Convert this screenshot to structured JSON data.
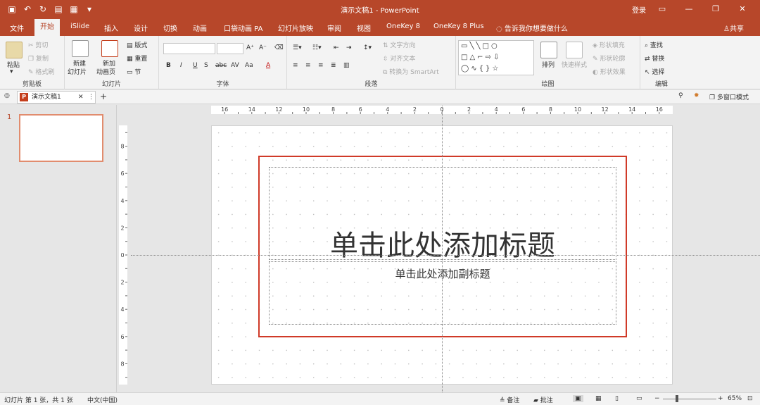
{
  "titlebar": {
    "doc_title": "演示文稿1  -  PowerPoint",
    "login": "登录",
    "qat": [
      "save-icon",
      "undo-icon",
      "redo-icon",
      "start-from-beginning-icon",
      "save-as-icon",
      "customize-icon"
    ]
  },
  "tabs": [
    "文件",
    "开始",
    "iSlide",
    "插入",
    "设计",
    "切换",
    "动画",
    "口袋动画 PA",
    "幻灯片放映",
    "审阅",
    "视图",
    "OneKey 8",
    "OneKey 8 Plus"
  ],
  "active_tab": "开始",
  "tellme": "告诉我你想要做什么",
  "share": "共享",
  "ribbon": {
    "clipboard": {
      "label": "剪贴板",
      "paste": "粘贴",
      "cut": "剪切",
      "copy": "复制",
      "format_painter": "格式刷"
    },
    "slides": {
      "label": "幻灯片",
      "new_slide": "新建\n幻灯片",
      "new_slide_l1": "新建",
      "new_slide_l2": "幻灯片",
      "add_page_l1": "新加",
      "add_page_l2": "动画页",
      "layout": "版式",
      "reset": "重置",
      "section": "节"
    },
    "font": {
      "label": "字体",
      "bold": "B",
      "italic": "I",
      "underline": "U",
      "shadow": "S",
      "strike": "abc",
      "spacing": "AV",
      "case": "Aa",
      "color": "A"
    },
    "paragraph": {
      "label": "段落",
      "text_direction": "文字方向",
      "align_text": "对齐文本",
      "smartart": "转换为 SmartArt"
    },
    "drawing": {
      "label": "绘图",
      "arrange": "排列",
      "quick_styles": "快速样式",
      "fill": "形状填充",
      "outline": "形状轮廓",
      "effects": "形状效果"
    },
    "editing": {
      "label": "编辑",
      "find": "查找",
      "replace": "替换",
      "select": "选择"
    }
  },
  "doctab": {
    "name": "演示文稿1",
    "multi_window": "多窗口模式"
  },
  "thumb": {
    "number": "1"
  },
  "slide": {
    "title_placeholder": "单击此处添加标题",
    "subtitle_placeholder": "单击此处添加副标题"
  },
  "status": {
    "slide_info": "幻灯片 第 1 张，共 1 张",
    "language": "中文(中国)",
    "notes": "备注",
    "comments": "批注",
    "zoom": "65%"
  },
  "colors": {
    "accent": "#b7472a",
    "frame": "#d03a28"
  }
}
